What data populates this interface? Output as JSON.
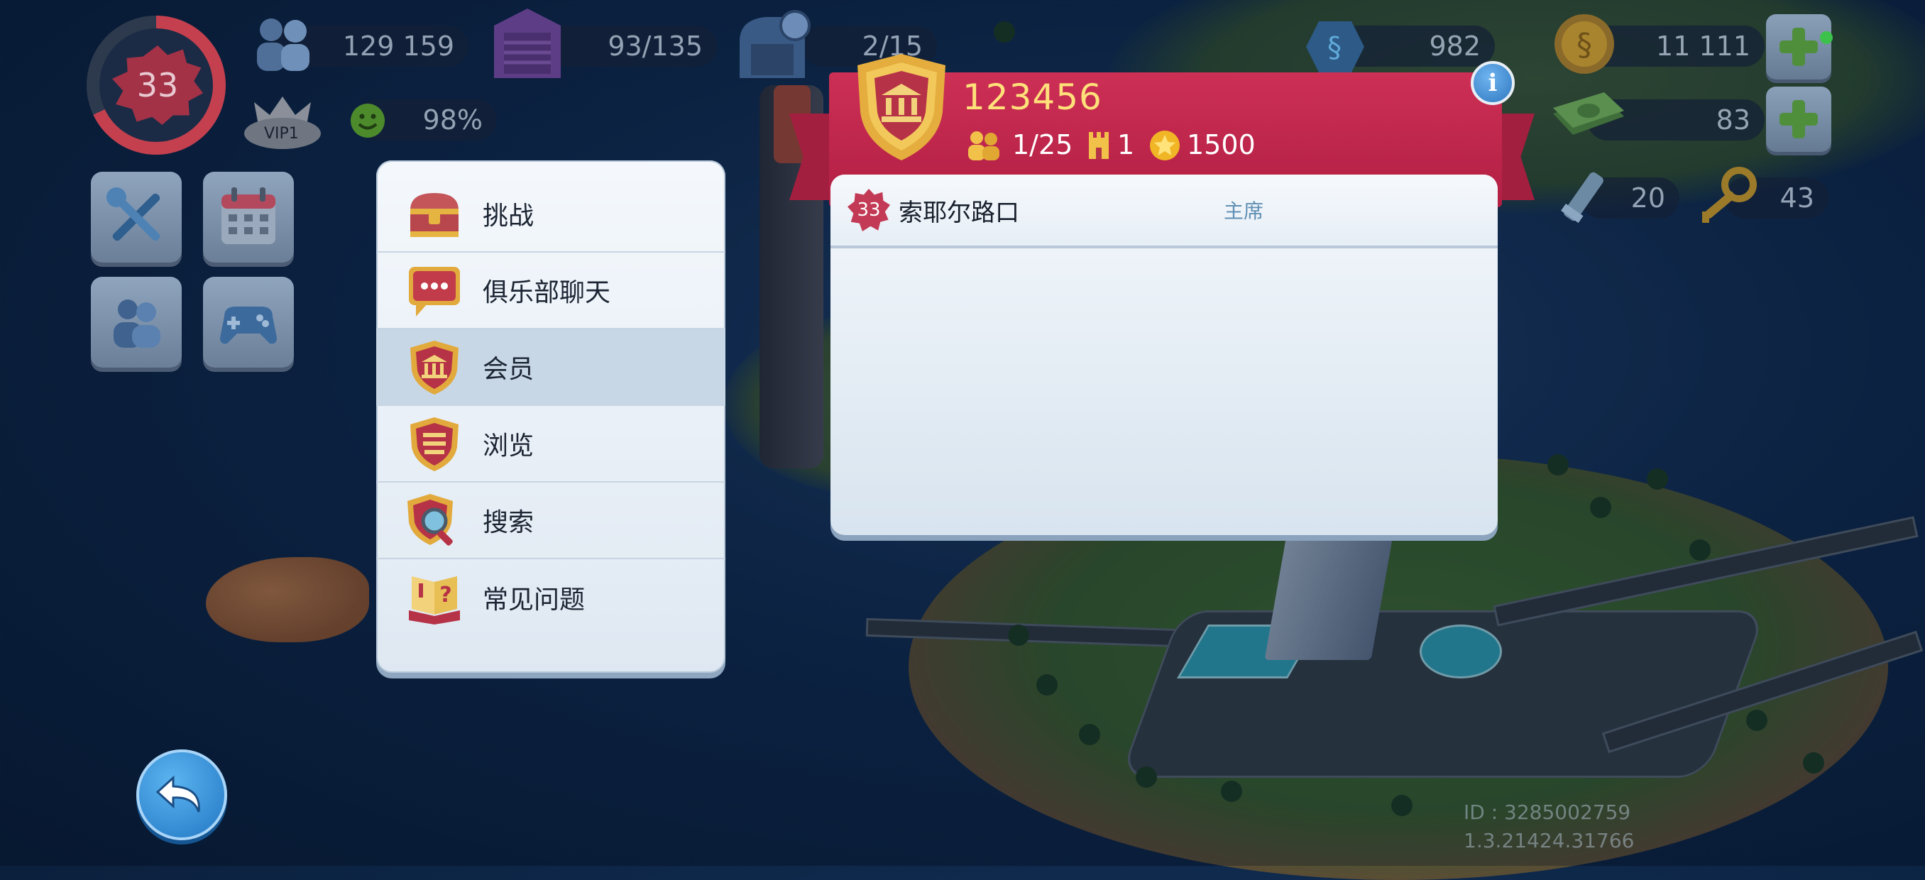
{
  "hud": {
    "level": "33",
    "population": "129 159",
    "storage": "93/135",
    "vehicles": "2/15",
    "happiness": "98%",
    "vip_label": "VIP1",
    "neo_simoleons": "982",
    "simoleons": "11 111",
    "simcash": "83",
    "platinum_keys": "20",
    "golden_keys": "43"
  },
  "menu": {
    "items": [
      {
        "label": "挑战",
        "icon": "treasure-chest-icon"
      },
      {
        "label": "俱乐部聊天",
        "icon": "chat-bubble-icon"
      },
      {
        "label": "会员",
        "icon": "club-shield-icon"
      },
      {
        "label": "浏览",
        "icon": "browse-shield-icon"
      },
      {
        "label": "搜索",
        "icon": "search-shield-icon"
      },
      {
        "label": "常见问题",
        "icon": "faq-book-icon"
      }
    ],
    "active_index": 2
  },
  "club": {
    "name": "123456",
    "members": "1/25",
    "towers": "1",
    "points": "1500",
    "member_list": [
      {
        "level": "33",
        "name": "索耶尔路口",
        "role": "主席"
      }
    ]
  },
  "footer": {
    "id_text": "ID : 3285002759",
    "version": "1.3.21424.31766"
  },
  "colors": {
    "ribbon": "#c02a4e",
    "club_name": "#ffe17a",
    "role_text": "#5f8fb3",
    "plus_green": "#4f8f3c"
  }
}
